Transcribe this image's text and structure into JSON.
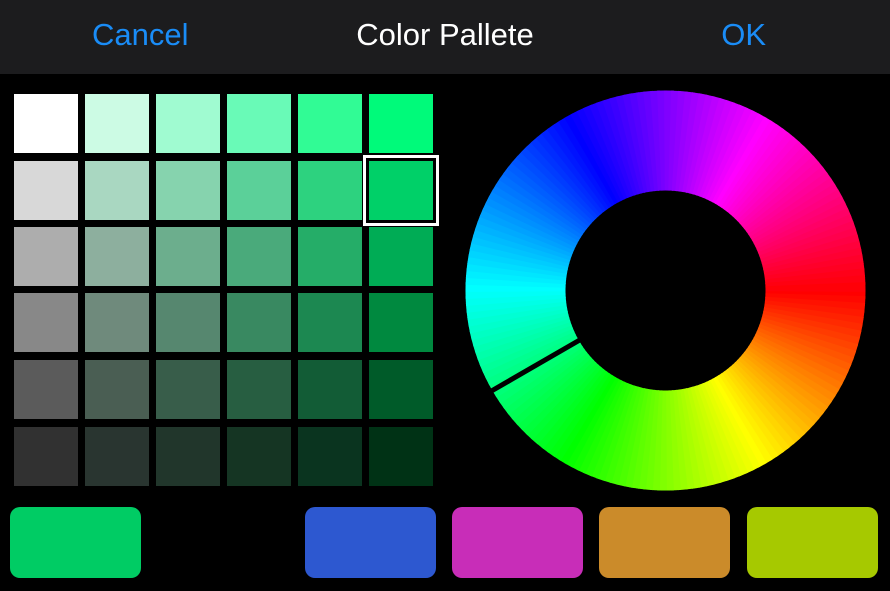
{
  "header": {
    "cancel_label": "Cancel",
    "title": "Color Pallete",
    "ok_label": "OK"
  },
  "accent_color": "#1a8cf6",
  "palette_grid": {
    "selected": [
      1,
      5
    ],
    "rows": [
      [
        "#ffffff",
        "#ccfbe4",
        "#a0fbd1",
        "#69fab7",
        "#31fb95",
        "#00fa7a"
      ],
      [
        "#d8d8d8",
        "#a9d7c1",
        "#86d3ae",
        "#5bd099",
        "#2dd27f",
        "#00d068"
      ],
      [
        "#adadad",
        "#8daf9e",
        "#6cae8d",
        "#4aaa7b",
        "#25ad68",
        "#00ac55"
      ],
      [
        "#888888",
        "#6f8a7c",
        "#56876f",
        "#398961",
        "#1c8851",
        "#00893f"
      ],
      [
        "#5b5b5b",
        "#4a5e53",
        "#385d4a",
        "#275e41",
        "#125c36",
        "#005b29"
      ],
      [
        "#313131",
        "#293530",
        "#21362b",
        "#153523",
        "#0a341f",
        "#003215"
      ]
    ]
  },
  "color_wheel": {
    "marker_hue_deg": 150,
    "segments": 180
  },
  "swatches": [
    {
      "name": "green",
      "color": "#00cc64"
    },
    {
      "name": "empty",
      "color": ""
    },
    {
      "name": "blue",
      "color": "#2d58d0"
    },
    {
      "name": "magenta",
      "color": "#c82db8"
    },
    {
      "name": "orange",
      "color": "#cb8b2a"
    },
    {
      "name": "lime",
      "color": "#a6c900"
    }
  ]
}
